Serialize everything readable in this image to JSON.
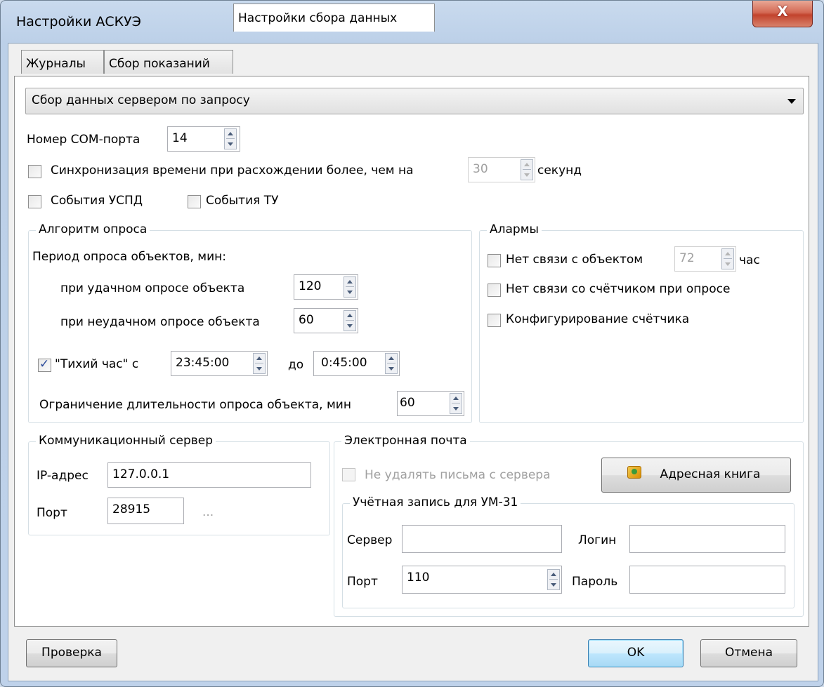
{
  "window": {
    "title": "Настройки АСКУЭ",
    "close_label": "X"
  },
  "tabs": [
    {
      "label": "Журналы"
    },
    {
      "label": "Сбор показаний"
    },
    {
      "label": "Настройки сбора данных",
      "active": true
    }
  ],
  "mode_select": {
    "selected": "Сбор данных сервером по запросу"
  },
  "com_port": {
    "label": "Номер COM-порта",
    "value": "14"
  },
  "time_sync": {
    "label": "Синхронизация времени при расхождении более, чем на",
    "checked": false,
    "value": "30",
    "unit": "секунд"
  },
  "events_uspd": {
    "label": "События УСПД",
    "checked": false
  },
  "events_tu": {
    "label": "События ТУ",
    "checked": false
  },
  "poll_algorithm": {
    "title": "Алгоритм опроса",
    "period_label": "Период опроса объектов, мин:",
    "success_label": "при удачном опросе объекта",
    "success_value": "120",
    "fail_label": "при неудачном опросе объекта",
    "fail_value": "60",
    "quiet_label": "\"Тихий час\" с",
    "quiet_checked": true,
    "quiet_from": "23:45:00",
    "quiet_to_label": "до",
    "quiet_to": "0:45:00",
    "limit_label": "Ограничение длительности опроса объекта, мин",
    "limit_value": "60"
  },
  "alarms": {
    "title": "Алармы",
    "no_link_label": "Нет связи с объектом",
    "no_link_value": "72",
    "no_link_unit": "час",
    "no_meter_label": "Нет связи со счётчиком при опросе",
    "config_label": "Конфигурирование счётчика"
  },
  "comm_server": {
    "title": "Коммуникационный сервер",
    "ip_label": "IP-адрес",
    "ip_value": "127.0.0.1",
    "port_label": "Порт",
    "port_value": "28915",
    "ellipsis": "..."
  },
  "email": {
    "title": "Электронная почта",
    "keep_label": "Не удалять письма с сервера",
    "address_book_label": "Адресная книга",
    "account": {
      "title": "Учётная запись для УМ-31",
      "server_label": "Сервер",
      "server_value": "",
      "login_label": "Логин",
      "login_value": "",
      "port_label": "Порт",
      "port_value": "110",
      "password_label": "Пароль",
      "password_value": ""
    }
  },
  "buttons": {
    "check": "Проверка",
    "ok": "OK",
    "cancel": "Отмена"
  }
}
